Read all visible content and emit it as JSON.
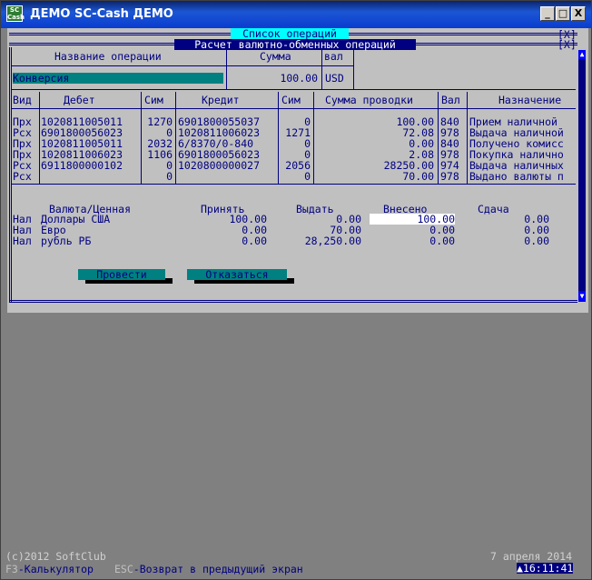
{
  "window": {
    "title": "ДЕМО SC-Cash ДЕМО",
    "icon_label": "SC\nCash",
    "minimize": "_",
    "maximize": "□",
    "close": "X"
  },
  "outer_panel": {
    "title": "Список операций",
    "close": "[X]"
  },
  "inner_panel": {
    "title": "Расчет валютно-обменных операций",
    "close": "[X]"
  },
  "operation": {
    "header_name": "Название операции",
    "header_sum": "Сумма",
    "header_val": "вал",
    "name": "Конверсия",
    "sum": "100.00",
    "currency": "USD"
  },
  "entries": {
    "columns": [
      "Вид",
      "Дебет",
      "Сим",
      "Кредит",
      "Сим",
      "Сумма проводки",
      "Вал",
      "Назначение"
    ],
    "rows": [
      [
        "Прх",
        "1020811005011",
        "1270",
        "6901800055037",
        "0",
        "100.00",
        "840",
        "Прием наличной"
      ],
      [
        "Рсх",
        "6901800056023",
        "0",
        "1020811006023",
        "1271",
        "72.08",
        "978",
        "Выдача наличной"
      ],
      [
        "Прх",
        "1020811005011",
        "2032",
        "6/8370/0-840",
        "0",
        "0.00",
        "840",
        "Получено комисс"
      ],
      [
        "Прх",
        "1020811006023",
        "1106",
        "6901800056023",
        "0",
        "2.08",
        "978",
        "Покупка налично"
      ],
      [
        "Рсх",
        "6911800000102",
        "0",
        "1020800000027",
        "2056",
        "28250.00",
        "974",
        "Выдача наличных"
      ],
      [
        "Рсх",
        "",
        "0",
        "",
        "0",
        "70.00",
        "978",
        "Выдано валюты п"
      ]
    ]
  },
  "cash": {
    "columns": [
      "Валюта/Ценная",
      "Принять",
      "Выдать",
      "Внесено",
      "Сдача"
    ],
    "rows": [
      [
        "Нал",
        "Доллары США",
        "100.00",
        "0.00",
        "100.00",
        "0.00"
      ],
      [
        "Нал",
        "Евро",
        "0.00",
        "70.00",
        "0.00",
        "0.00"
      ],
      [
        "Нал",
        "рубль РБ",
        "0.00",
        "28,250.00",
        "0.00",
        "0.00"
      ]
    ]
  },
  "buttons": {
    "confirm": "Провести",
    "cancel": "Отказаться"
  },
  "footer": {
    "copyright": "(c)2012 SoftClub",
    "date": "7 апреля 2014",
    "f3_key": "F3",
    "f3_desc": "-Калькулятор",
    "esc_key": "ESC",
    "esc_desc": "-Возврат в предыдущий экран",
    "clock": "▲16:11:41"
  },
  "colors": {
    "console_bg": "#c0c0c0",
    "text_blue": "#000080",
    "accent_teal": "#008080",
    "title_cyan": "#00ffff"
  }
}
